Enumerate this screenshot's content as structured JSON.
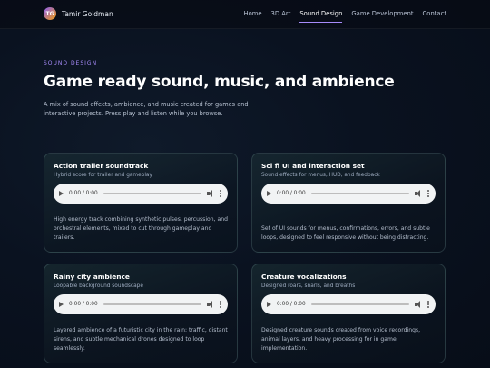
{
  "brand": {
    "initials": "TG",
    "name": "Tamir Goldman"
  },
  "nav": [
    "Home",
    "3D Art",
    "Sound Design",
    "Game Development",
    "Contact"
  ],
  "hero": {
    "eyebrow": "SOUND DESIGN",
    "title": "Game ready sound, music, and ambience",
    "intro": "A mix of sound effects, ambience, and music created for games and interactive projects. Press play and listen while you browse."
  },
  "cards": [
    {
      "title": "Action trailer soundtrack",
      "subtitle": "Hybrid score for trailer and gameplay",
      "time": "0:00 / 0:00",
      "description": "High energy track combining synthetic pulses, percussion, and orchestral elements, mixed to cut through gameplay and trailers."
    },
    {
      "title": "Sci fi UI and interaction set",
      "subtitle": "Sound effects for menus, HUD, and feedback",
      "time": "0:00 / 0:00",
      "description": "Set of UI sounds for menus, confirmations, errors, and subtle loops, designed to feel responsive without being distracting."
    },
    {
      "title": "Rainy city ambience",
      "subtitle": "Loopable background soundscape",
      "time": "0:00 / 0:00",
      "description": "Layered ambience of a futuristic city in the rain: traffic, distant sirens, and subtle mechanical drones designed to loop seamlessly."
    },
    {
      "title": "Creature vocalizations",
      "subtitle": "Designed roars, snarls, and breaths",
      "time": "0:00 / 0:00",
      "description": "Designed creature sounds created from voice recordings, animal layers, and heavy processing for in game implementation."
    }
  ]
}
